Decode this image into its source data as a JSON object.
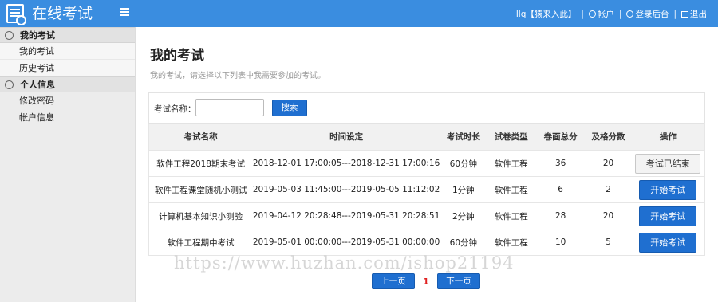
{
  "header": {
    "app_title": "在线考试",
    "user_label": "llq【猿来入此】",
    "account_label": "帐户",
    "admin_label": "登录后台",
    "logout_label": "退出"
  },
  "sidebar": {
    "sections": [
      {
        "title": "我的考试",
        "icon": "clock-icon",
        "items": [
          "我的考试",
          "历史考试"
        ]
      },
      {
        "title": "个人信息",
        "icon": "user-icon",
        "items": [
          "修改密码",
          "帐户信息"
        ]
      }
    ]
  },
  "main": {
    "title": "我的考试",
    "subtitle": "我的考试，请选择以下列表中我需要参加的考试。",
    "search": {
      "label": "考试名称：",
      "value": "",
      "placeholder": "",
      "button": "搜索"
    },
    "table": {
      "headers": [
        "考试名称",
        "时间设定",
        "考试时长",
        "试卷类型",
        "卷面总分",
        "及格分数",
        "操作"
      ],
      "rows": [
        {
          "name": "软件工程2018期末考试",
          "time": "2018-12-01 17:00:05---2018-12-31 17:00:16",
          "duration": "60分钟",
          "type": "软件工程",
          "total": "36",
          "pass": "20",
          "action": "考试已结束",
          "status": "ended"
        },
        {
          "name": "软件工程课堂随机小测试",
          "time": "2019-05-03 11:45:00---2019-05-05 11:12:02",
          "duration": "1分钟",
          "type": "软件工程",
          "total": "6",
          "pass": "2",
          "action": "开始考试",
          "status": "open"
        },
        {
          "name": "计算机基本知识小测验",
          "time": "2019-04-12 20:28:48---2019-05-31 20:28:51",
          "duration": "2分钟",
          "type": "软件工程",
          "total": "28",
          "pass": "20",
          "action": "开始考试",
          "status": "open"
        },
        {
          "name": "软件工程期中考试",
          "time": "2019-05-01 00:00:00---2019-05-31 00:00:00",
          "duration": "60分钟",
          "type": "软件工程",
          "total": "10",
          "pass": "5",
          "action": "开始考试",
          "status": "open"
        }
      ]
    },
    "pagination": {
      "prev": "上一页",
      "current": "1",
      "next": "下一页"
    }
  },
  "watermark": "https://www.huzhan.com/ishop21194",
  "colors": {
    "header_bg": "#3a8de0",
    "button_primary": "#1f6fd0",
    "current_page": "#e02020"
  }
}
